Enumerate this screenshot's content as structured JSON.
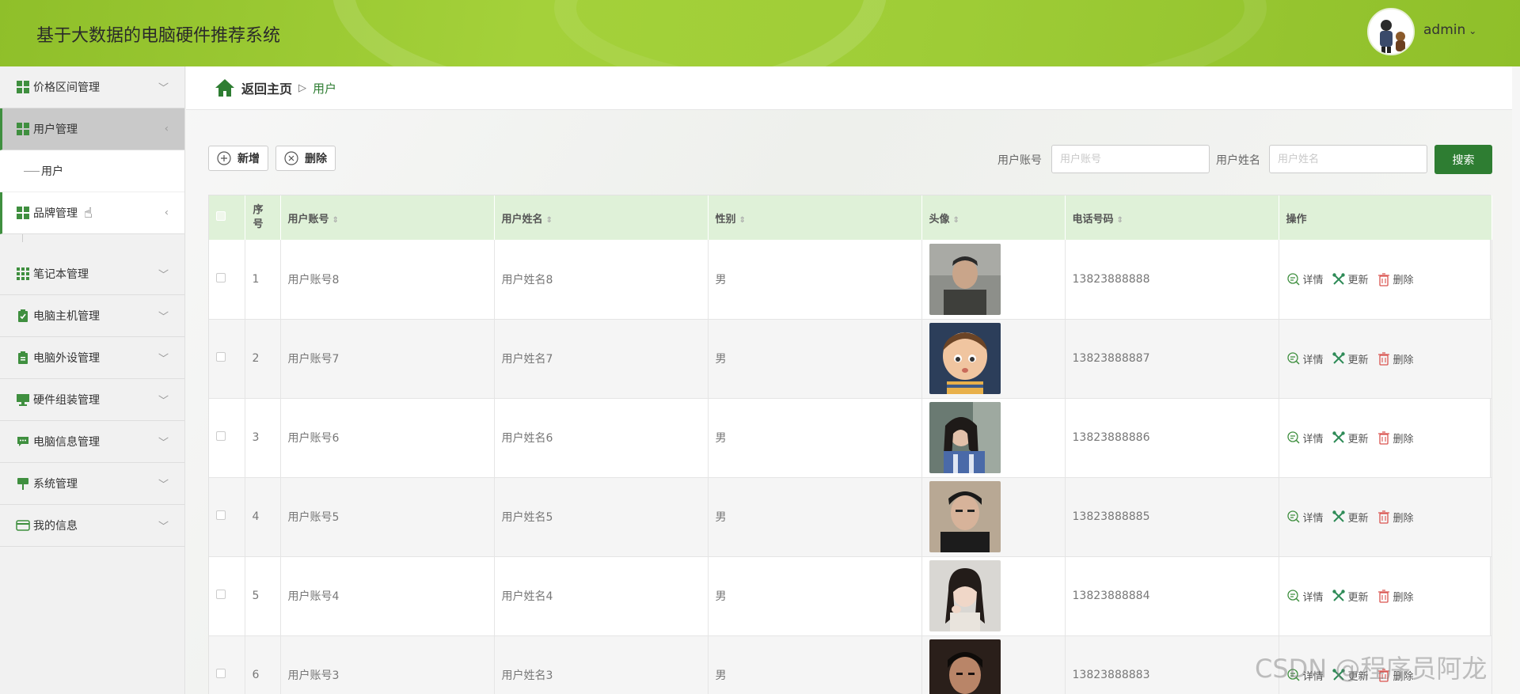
{
  "app": {
    "title": "基于大数据的电脑硬件推荐系统"
  },
  "user": {
    "name": "admin",
    "chevron": "⌄"
  },
  "sidebar": {
    "items": [
      {
        "label": "价格区间管理",
        "icon": "grid-icon"
      },
      {
        "label": "用户管理",
        "icon": "grid-icon",
        "state": "expanded"
      },
      {
        "label": "用户",
        "type": "sub"
      },
      {
        "label": "品牌管理",
        "icon": "grid-icon",
        "state": "hover"
      },
      {
        "label": "笔记本管理",
        "icon": "apps-icon"
      },
      {
        "label": "电脑主机管理",
        "icon": "clipboard-check-icon"
      },
      {
        "label": "电脑外设管理",
        "icon": "clipboard-icon"
      },
      {
        "label": "硬件组装管理",
        "icon": "monitor-icon"
      },
      {
        "label": "电脑信息管理",
        "icon": "chat-icon"
      },
      {
        "label": "系统管理",
        "icon": "flag-icon"
      },
      {
        "label": "我的信息",
        "icon": "card-icon"
      }
    ]
  },
  "breadcrumb": {
    "home": "返回主页",
    "sep": "▷",
    "current": "用户"
  },
  "toolbar": {
    "add_label": "新增",
    "delete_label": "删除"
  },
  "search": {
    "account_label": "用户账号",
    "account_placeholder": "用户账号",
    "name_label": "用户姓名",
    "name_placeholder": "用户姓名",
    "button_label": "搜索"
  },
  "table": {
    "headers": [
      "序号",
      "用户账号",
      "用户姓名",
      "性别",
      "头像",
      "电话号码",
      "操作"
    ],
    "actions": {
      "detail": "详情",
      "update": "更新",
      "delete": "删除"
    },
    "rows": [
      {
        "index": "1",
        "account": "用户账号8",
        "name": "用户姓名8",
        "gender": "男",
        "phone": "13823888888",
        "avatar": "avatar-man-1"
      },
      {
        "index": "2",
        "account": "用户账号7",
        "name": "用户姓名7",
        "gender": "男",
        "phone": "13823888887",
        "avatar": "avatar-cartoon-boy"
      },
      {
        "index": "3",
        "account": "用户账号6",
        "name": "用户姓名6",
        "gender": "男",
        "phone": "13823888886",
        "avatar": "avatar-woman-1"
      },
      {
        "index": "4",
        "account": "用户账号5",
        "name": "用户姓名5",
        "gender": "男",
        "phone": "13823888885",
        "avatar": "avatar-man-2"
      },
      {
        "index": "5",
        "account": "用户账号4",
        "name": "用户姓名4",
        "gender": "男",
        "phone": "13823888884",
        "avatar": "avatar-woman-2"
      },
      {
        "index": "6",
        "account": "用户账号3",
        "name": "用户姓名3",
        "gender": "男",
        "phone": "13823888883",
        "avatar": "avatar-man-3"
      }
    ]
  },
  "colors": {
    "brand": "#9fcd37",
    "accent": "#2e7d32",
    "header_row": "#dff1d8"
  },
  "watermark": "CSDN @程序员阿龙"
}
